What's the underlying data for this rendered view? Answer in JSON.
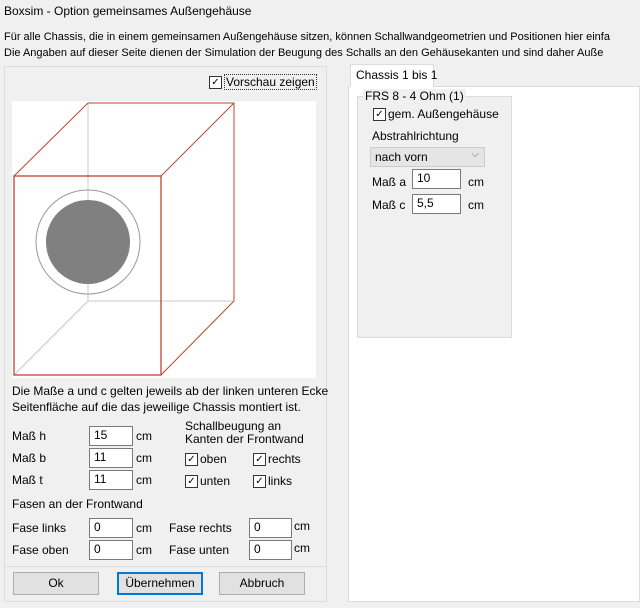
{
  "window": {
    "title": "Boxsim - Option gemeinsames Außengehäuse"
  },
  "intro": [
    "Für alle Chassis, die in einem gemeinsamen Außengehäuse sitzen, können Schallwandgeometrien und Positionen hier einfa",
    "Die Angaben auf dieser Seite dienen der Simulation der  Beugung des Schalls an den Gehäusekanten und sind daher Auße"
  ],
  "preview": {
    "show_label": "Vorschau zeigen",
    "checked": true,
    "box_color": "#c0442c",
    "driver_color": "#808080"
  },
  "note": [
    "Die Maße a und c gelten jeweils ab der linken unteren Ecke",
    "Seitenfläche auf die das jeweilige Chassis montiert ist."
  ],
  "dims": [
    {
      "label": "Maß h",
      "value": "15",
      "unit": "cm"
    },
    {
      "label": "Maß b",
      "value": "11",
      "unit": "cm"
    },
    {
      "label": "Maß t",
      "value": "11",
      "unit": "cm"
    }
  ],
  "diffraction": {
    "title": [
      "Schallbeugung an",
      "Kanten der Frontwand"
    ],
    "oben": "oben",
    "rechts": "rechts",
    "unten": "unten",
    "links": "links"
  },
  "chamfer": {
    "title": "Fasen an der Frontwand",
    "links": {
      "label": "Fase links",
      "value": "0",
      "unit": "cm"
    },
    "oben": {
      "label": "Fase oben",
      "value": "0",
      "unit": "cm"
    },
    "rechts": {
      "label": "Fase rechts",
      "value": "0",
      "unit": "cm"
    },
    "unten": {
      "label": "Fase unten",
      "value": "0",
      "unit": "cm"
    }
  },
  "buttons": {
    "ok": "Ok",
    "apply": "Übernehmen",
    "cancel": "Abbruch"
  },
  "tab": {
    "label": "Chassis 1 bis 1"
  },
  "chassis": {
    "group": "FRS 8 - 4 Ohm (1)",
    "shared_label": "gem. Außengehäuse",
    "direction_label": "Abstrahlrichtung",
    "direction_value": "nach vorn",
    "a": {
      "label": "Maß a",
      "value": "10",
      "unit": "cm"
    },
    "c": {
      "label": "Maß c",
      "value": "5,5",
      "unit": "cm"
    }
  }
}
